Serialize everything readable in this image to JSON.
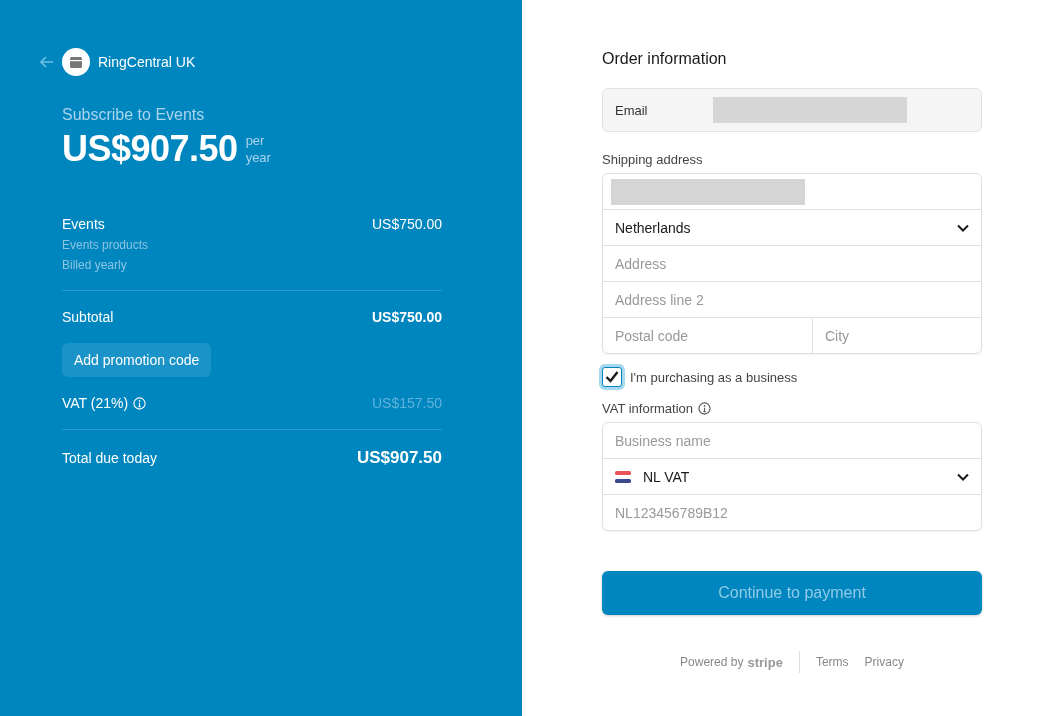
{
  "merchant": {
    "name": "RingCentral UK"
  },
  "summary": {
    "title": "Subscribe to Events",
    "price": "US$907.50",
    "period_top": "per",
    "period_bottom": "year"
  },
  "line_items": [
    {
      "name": "Events",
      "details": [
        "Events products",
        "Billed yearly"
      ],
      "amount": "US$750.00"
    }
  ],
  "subtotal": {
    "label": "Subtotal",
    "amount": "US$750.00"
  },
  "promo_button": "Add promotion code",
  "vat": {
    "label": "VAT (21%)",
    "amount": "US$157.50"
  },
  "total": {
    "label": "Total due today",
    "amount": "US$907.50"
  },
  "order": {
    "title": "Order information",
    "email_label": "Email"
  },
  "shipping": {
    "label": "Shipping address",
    "country": "Netherlands",
    "address_placeholder": "Address",
    "address2_placeholder": "Address line 2",
    "postal_placeholder": "Postal code",
    "city_placeholder": "City"
  },
  "business": {
    "label": "I'm purchasing as a business",
    "checked": true
  },
  "vat_info": {
    "label": "VAT information",
    "business_placeholder": "Business name",
    "vat_type": "NL VAT",
    "vat_placeholder": "NL123456789B12"
  },
  "continue_button": {
    "label": "Continue to payment",
    "disabled": true
  },
  "footer": {
    "powered": "Powered by",
    "brand": "stripe",
    "links": [
      "Terms",
      "Privacy"
    ]
  }
}
